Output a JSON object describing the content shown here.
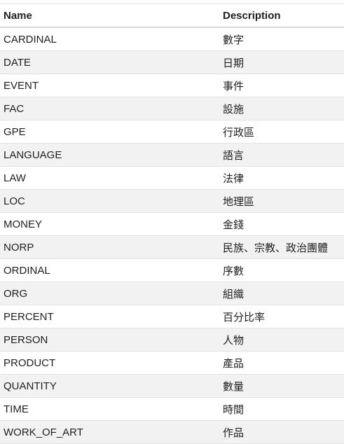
{
  "table": {
    "headers": {
      "name": "Name",
      "description": "Description"
    },
    "rows": [
      {
        "name": "CARDINAL",
        "description": "數字"
      },
      {
        "name": "DATE",
        "description": "日期"
      },
      {
        "name": "EVENT",
        "description": "事件"
      },
      {
        "name": "FAC",
        "description": "設施"
      },
      {
        "name": "GPE",
        "description": "行政區"
      },
      {
        "name": "LANGUAGE",
        "description": "語言"
      },
      {
        "name": "LAW",
        "description": "法律"
      },
      {
        "name": "LOC",
        "description": "地理區"
      },
      {
        "name": "MONEY",
        "description": "金錢"
      },
      {
        "name": "NORP",
        "description": "民族、宗教、政治團體"
      },
      {
        "name": "ORDINAL",
        "description": "序數"
      },
      {
        "name": "ORG",
        "description": "組織"
      },
      {
        "name": "PERCENT",
        "description": "百分比率"
      },
      {
        "name": "PERSON",
        "description": "人物"
      },
      {
        "name": "PRODUCT",
        "description": "產品"
      },
      {
        "name": "QUANTITY",
        "description": "數量"
      },
      {
        "name": "TIME",
        "description": "時間"
      },
      {
        "name": "WORK_OF_ART",
        "description": "作品"
      }
    ]
  }
}
